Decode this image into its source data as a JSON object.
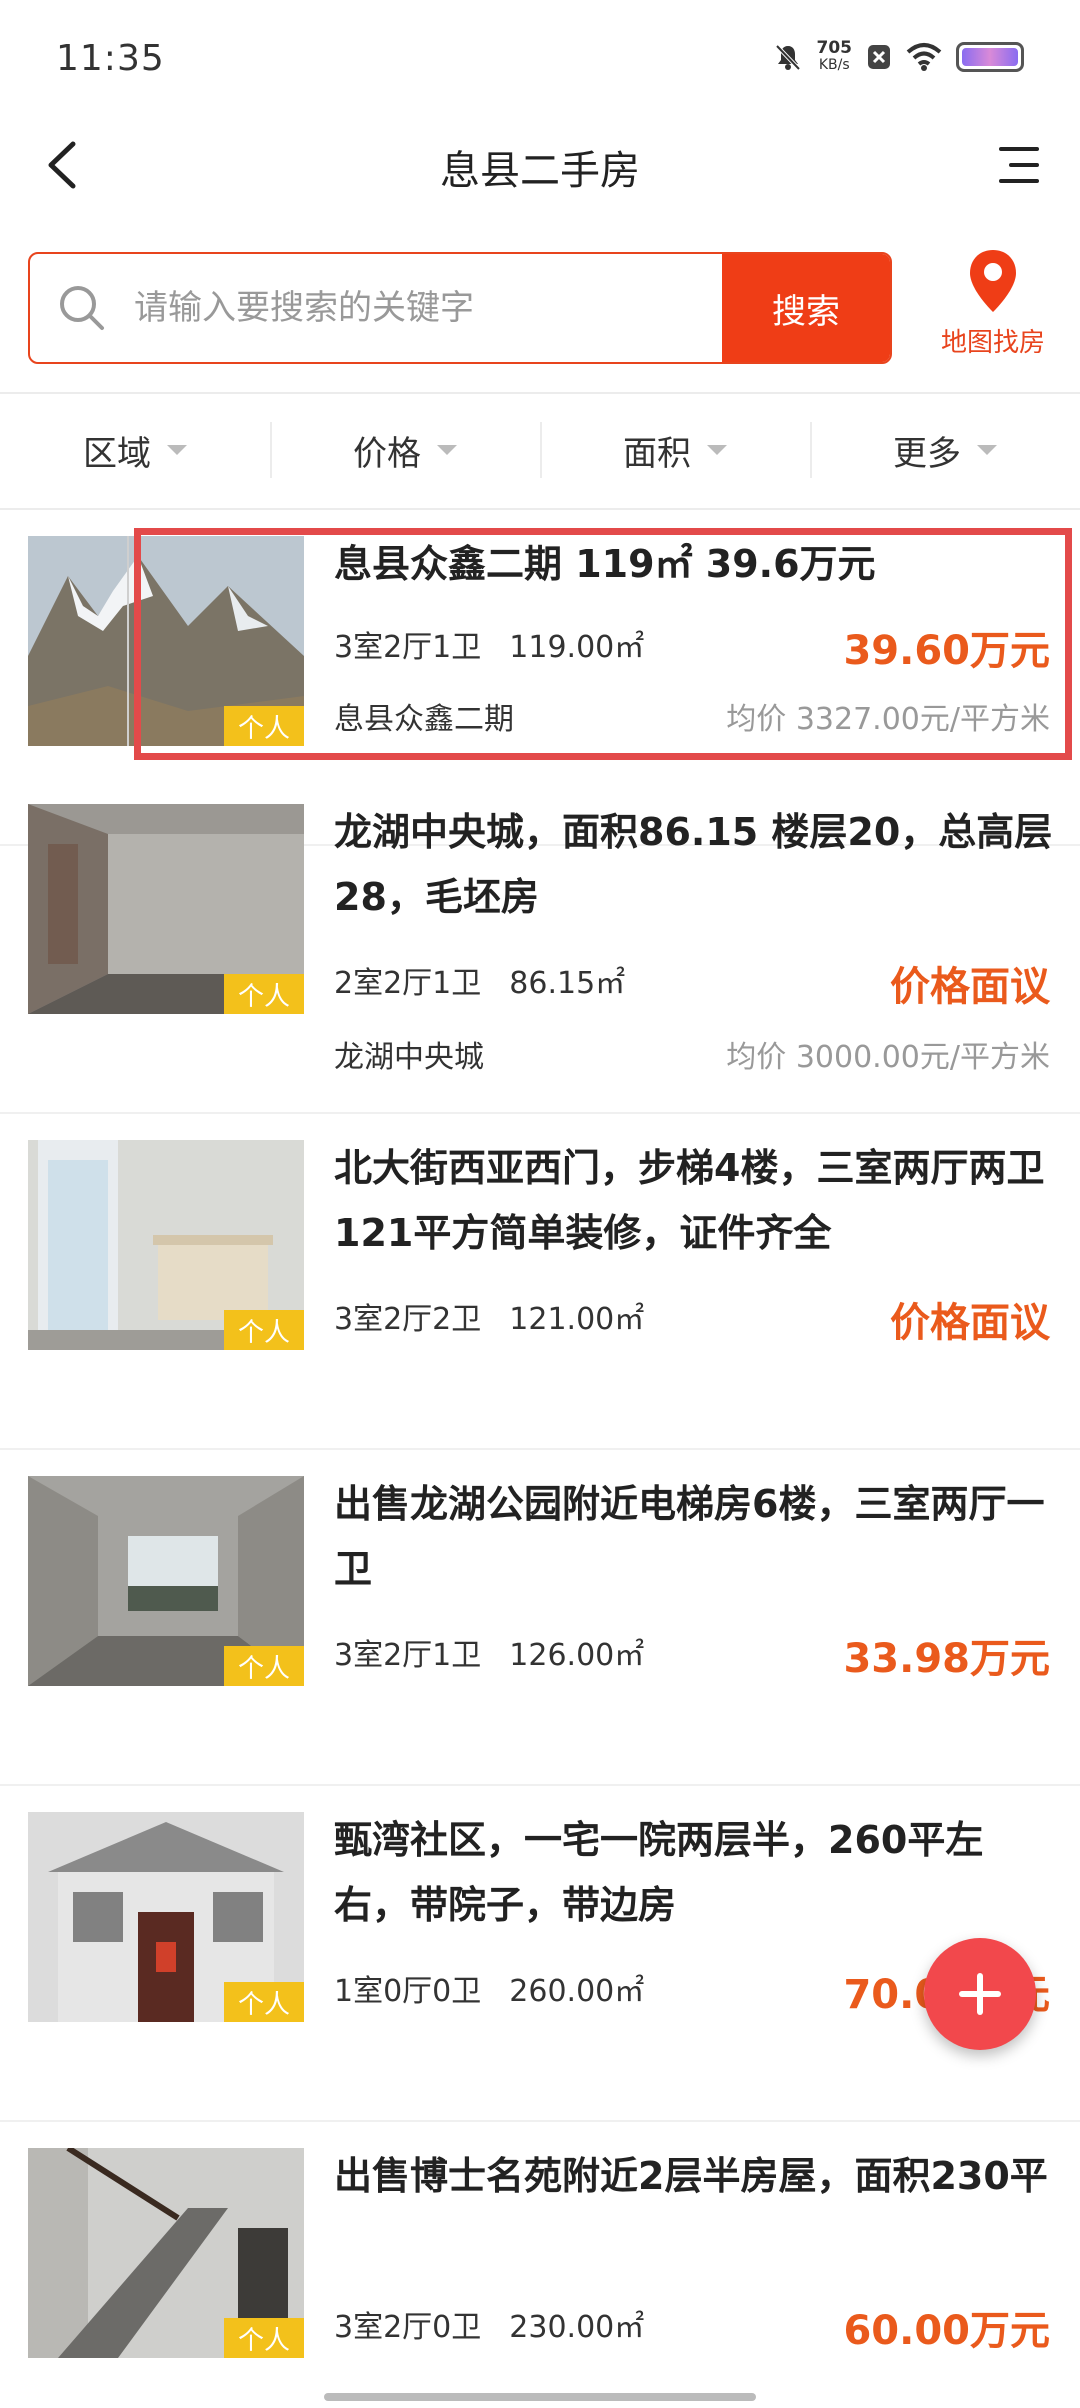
{
  "status_bar": {
    "time": "11:35",
    "net_speed": "705",
    "net_unit": "KB/s"
  },
  "header": {
    "title": "息县二手房"
  },
  "search": {
    "placeholder": "请输入要搜索的关键字",
    "button_label": "搜索",
    "map_label": "地图找房"
  },
  "filters": [
    {
      "label": "区域"
    },
    {
      "label": "价格"
    },
    {
      "label": "面积"
    },
    {
      "label": "更多"
    }
  ],
  "listings": [
    {
      "title": "息县众鑫二期 119㎡ 39.6万元",
      "layout": "3室2厅1卫",
      "size": "119.00㎡",
      "price": "39.60万元",
      "community": "息县众鑫二期",
      "unit_price": "均价 3327.00元/平方米",
      "badge": "个人"
    },
    {
      "title": "龙湖中央城，面积86.15 楼层20，总高层28，毛坯房",
      "layout": "2室2厅1卫",
      "size": "86.15㎡",
      "price": "价格面议",
      "community": "龙湖中央城",
      "unit_price": "均价 3000.00元/平方米",
      "badge": "个人"
    },
    {
      "title": "北大街西亚西门，步梯4楼，三室两厅两卫121平方简单装修，证件齐全",
      "layout": "3室2厅2卫",
      "size": "121.00㎡",
      "price": "价格面议",
      "badge": "个人"
    },
    {
      "title": "出售龙湖公园附近电梯房6楼，三室两厅一卫",
      "layout": "3室2厅1卫",
      "size": "126.00㎡",
      "price": "33.98万元",
      "badge": "个人"
    },
    {
      "title": "甄湾社区，一宅一院两层半，260平左右，带院子，带边房",
      "layout": "1室0厅0卫",
      "size": "260.00㎡",
      "price": "70.00万元",
      "badge": "个人"
    },
    {
      "title": "出售博士名苑附近2层半房屋，面积230平",
      "layout": "3室2厅0卫",
      "size": "230.00㎡",
      "price": "60.00万元",
      "badge": "个人"
    }
  ],
  "colors": {
    "accent": "#ef3d16",
    "price": "#ea5a1c",
    "badge": "#f3c11b",
    "fab": "#f2484c",
    "highlight": "#e34a4a"
  },
  "icons": [
    "back-arrow-icon",
    "menu-icon",
    "search-icon",
    "map-pin-icon",
    "plus-icon"
  ]
}
